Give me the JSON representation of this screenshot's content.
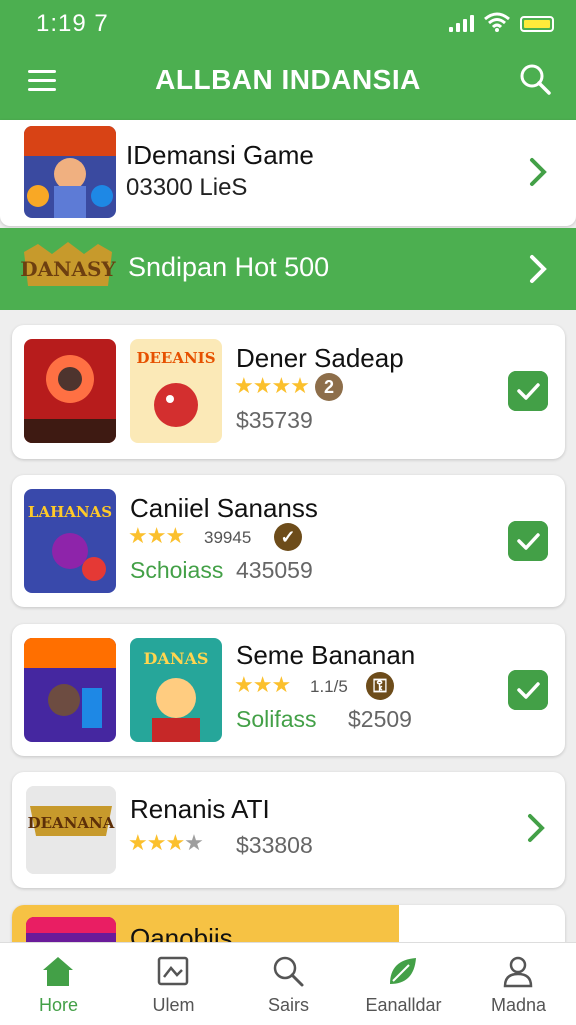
{
  "status_bar": {
    "time": "1:19 7"
  },
  "app_bar": {
    "title": "ALLBAN INDANSIA"
  },
  "featured": {
    "title": "IDemansi Game",
    "subtitle": "03300 LieS"
  },
  "banner": {
    "logo_text": "DANASY",
    "title": "Sndipan Hot 500"
  },
  "items": [
    {
      "title": "Dener Sadeap",
      "stars": 4,
      "badge": "2",
      "price": "$35739",
      "installed": true,
      "thumb_text": "DEEANIS"
    },
    {
      "title": "Caniiel Sananss",
      "stars": 3,
      "rating_text": "39945",
      "sub_green": "Schoiass",
      "price": "435059",
      "installed": true,
      "thumb_text": "LAHANAS"
    },
    {
      "title": "Seme Bananan",
      "stars": 3,
      "rating_text": "1.1/5",
      "sub_green": "Solifass",
      "price": "$2509",
      "installed": true,
      "thumb_text": "DANAS"
    },
    {
      "title": "Renanis ATI",
      "stars": 3,
      "max_stars": 4,
      "price": "$33808",
      "installed": false,
      "thumb_text": "DEANANA"
    },
    {
      "title": "Oanobiis"
    }
  ],
  "bottom_nav": [
    {
      "label": "Hore",
      "icon": "home-icon",
      "active": true
    },
    {
      "label": "Ulem",
      "icon": "image-icon",
      "active": false
    },
    {
      "label": "Sairs",
      "icon": "search-icon",
      "active": false
    },
    {
      "label": "Eanalldar",
      "icon": "leaf-icon",
      "active": false
    },
    {
      "label": "Madna",
      "icon": "profile-icon",
      "active": false
    }
  ],
  "colors": {
    "primary": "#4caf50",
    "check": "#43a047",
    "star": "#fbc02d",
    "price": "#666666"
  }
}
